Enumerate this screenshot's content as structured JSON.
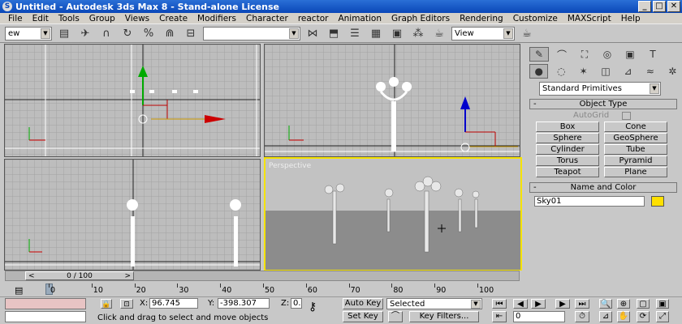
{
  "window": {
    "title": "Untitled - Autodesk 3ds Max 8 - Stand-alone License"
  },
  "menu": [
    "File",
    "Edit",
    "Tools",
    "Group",
    "Views",
    "Create",
    "Modifiers",
    "Character",
    "reactor",
    "Animation",
    "Graph Editors",
    "Rendering",
    "Customize",
    "MAXScript",
    "Help"
  ],
  "toolbar": {
    "selection_filter": "ew",
    "named_selection": "",
    "view_combo": "View"
  },
  "viewports": {
    "perspective_label": "Perspective"
  },
  "command_panel": {
    "dropdown": "Standard Primitives",
    "object_type": {
      "title": "Object Type",
      "autogrid": "AutoGrid",
      "buttons": [
        "Box",
        "Cone",
        "Sphere",
        "GeoSphere",
        "Cylinder",
        "Tube",
        "Torus",
        "Pyramid",
        "Teapot",
        "Plane"
      ]
    },
    "name_color": {
      "title": "Name and Color",
      "name_value": "Sky01",
      "color": "#ffe000"
    }
  },
  "timeline": {
    "frame_readout": "0 / 100",
    "ticks": [
      "0",
      "10",
      "20",
      "30",
      "40",
      "50",
      "60",
      "70",
      "80",
      "90",
      "100"
    ]
  },
  "status": {
    "x_label": "X:",
    "x_value": "96.745",
    "y_label": "Y:",
    "y_value": "-398.307",
    "z_label": "Z:",
    "z_value": "0.",
    "prompt": "Click and drag to select and move objects",
    "auto_key": "Auto Key",
    "set_key": "Set Key",
    "key_mode": "Selected",
    "key_filters": "Key Filters...",
    "frame_value": "0"
  }
}
